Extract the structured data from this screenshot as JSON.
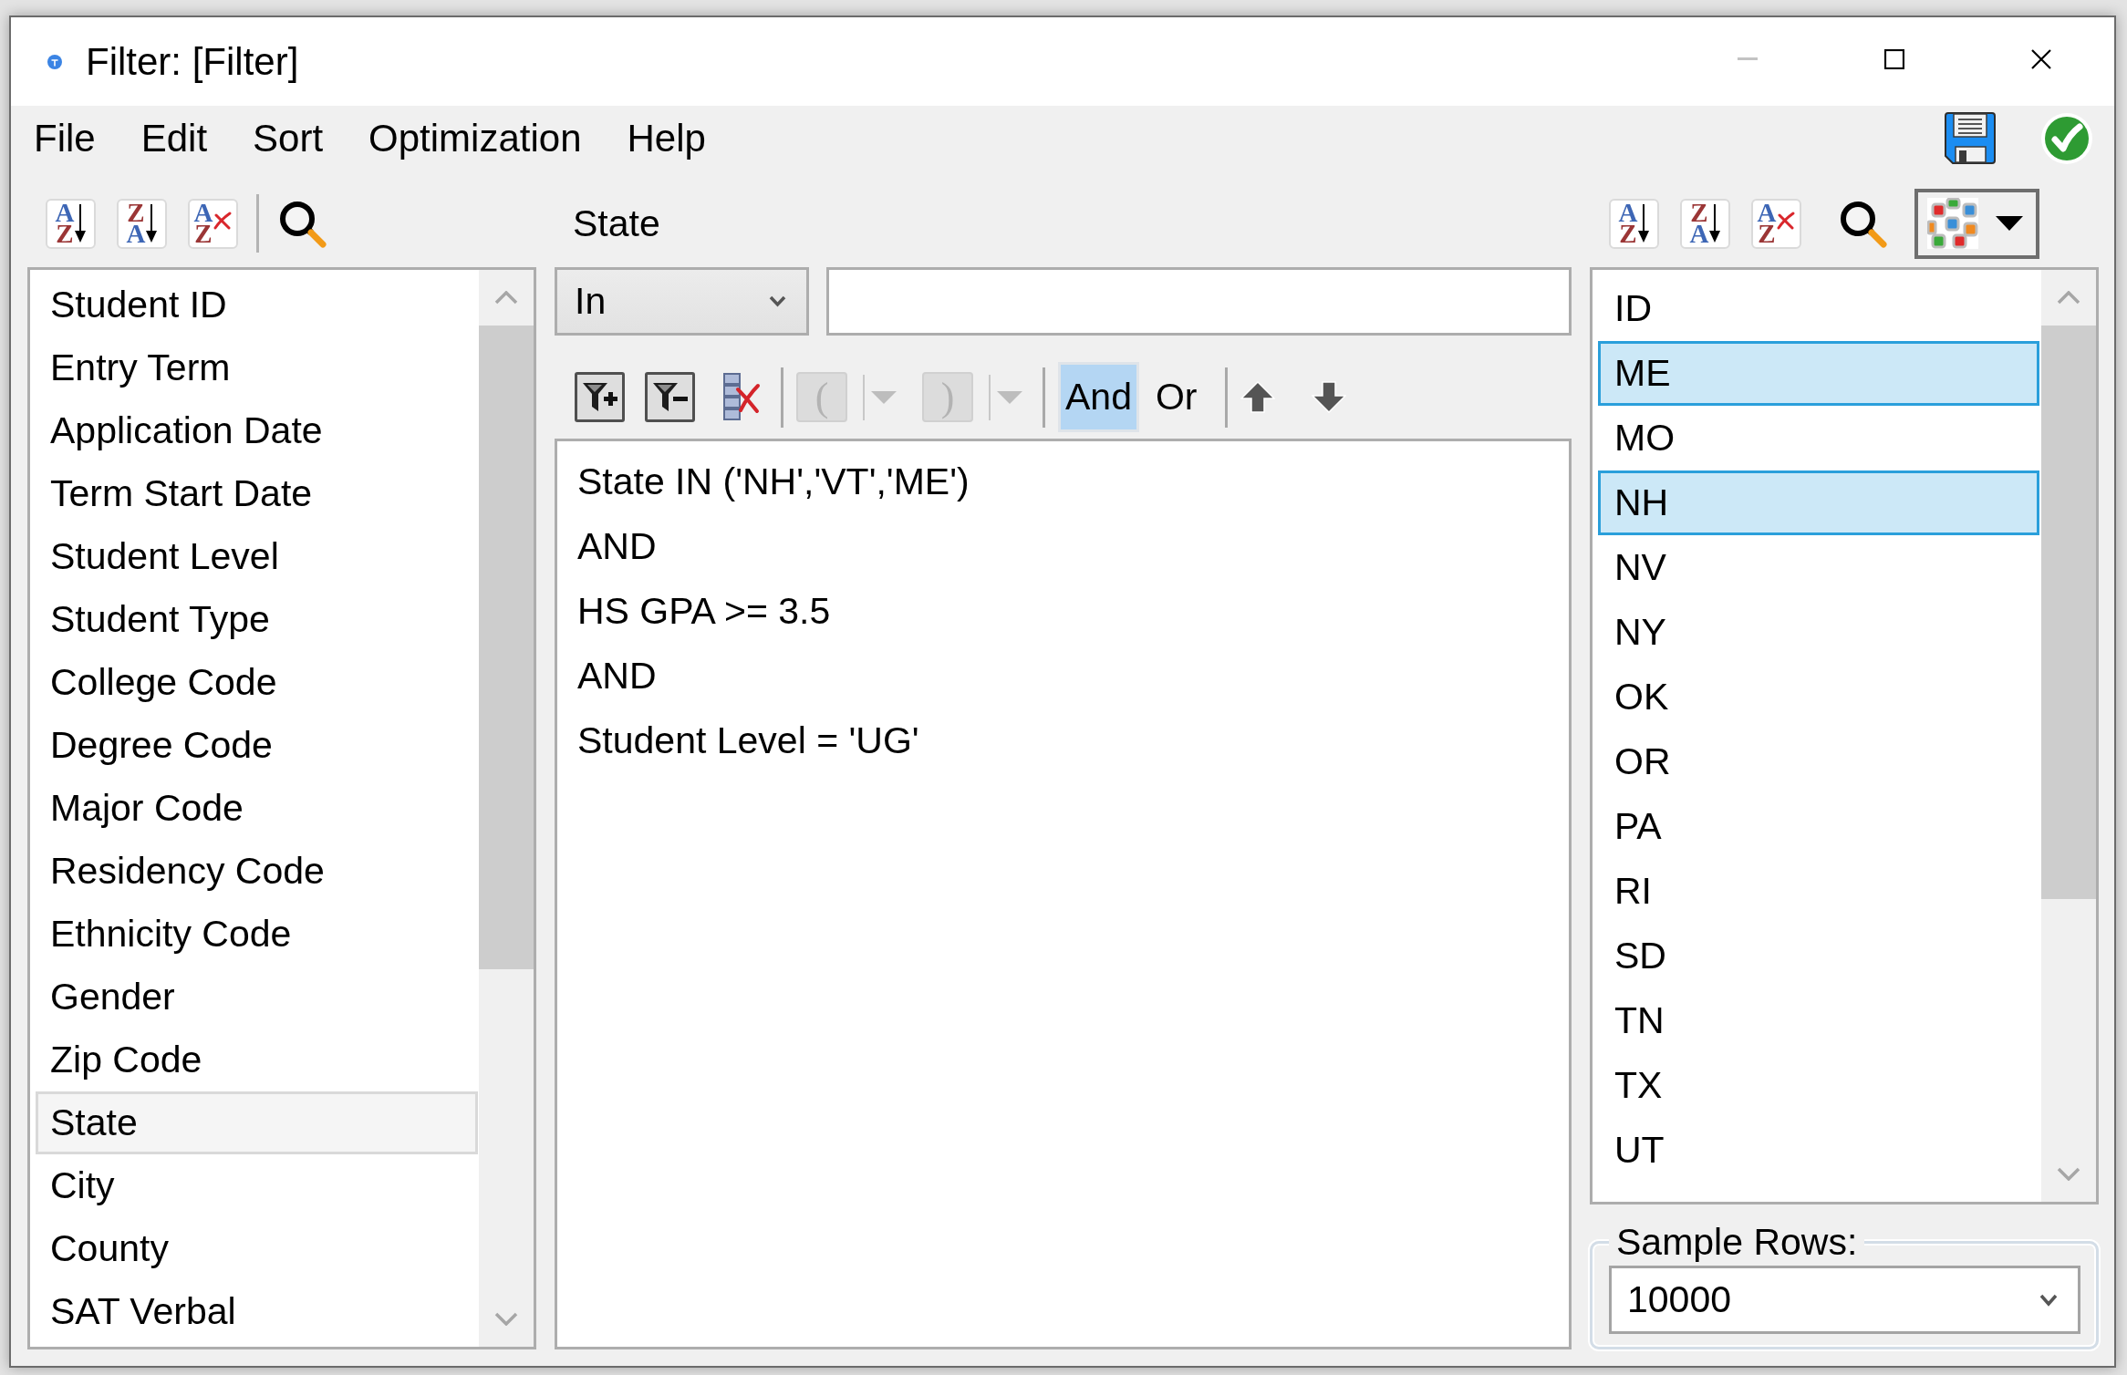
{
  "window": {
    "title": "Filter: [Filter]",
    "controls": [
      {
        "kind": "minimize",
        "disabled": true
      },
      {
        "kind": "maximize",
        "disabled": false
      },
      {
        "kind": "close",
        "disabled": false
      }
    ]
  },
  "menu": [
    "File",
    "Edit",
    "Sort",
    "Optimization",
    "Help"
  ],
  "menu_actions": [
    {
      "kind": "save"
    },
    {
      "kind": "apply"
    }
  ],
  "field_toolbar": {
    "groups": [
      [
        {
          "kind": "sort_ascending",
          "glyphs": [
            "A",
            "Z"
          ]
        },
        {
          "kind": "sort_descending",
          "glyphs": [
            "Z",
            "A"
          ]
        },
        {
          "kind": "clear_sort",
          "glyphs": [
            "A",
            "Z"
          ]
        }
      ],
      [
        {
          "kind": "search"
        }
      ]
    ]
  },
  "field_list": {
    "items": [
      {
        "label": "Student ID",
        "selected": false
      },
      {
        "label": "Entry Term",
        "selected": false
      },
      {
        "label": "Application Date",
        "selected": false
      },
      {
        "label": "Term Start Date",
        "selected": false
      },
      {
        "label": "Student Level",
        "selected": false
      },
      {
        "label": "Student Type",
        "selected": false
      },
      {
        "label": "College Code",
        "selected": false
      },
      {
        "label": "Degree Code",
        "selected": false
      },
      {
        "label": "Major Code",
        "selected": false
      },
      {
        "label": "Residency Code",
        "selected": false
      },
      {
        "label": "Ethnicity Code",
        "selected": false
      },
      {
        "label": "Gender",
        "selected": false
      },
      {
        "label": "Zip Code",
        "selected": false
      },
      {
        "label": "State",
        "selected": true
      },
      {
        "label": "City",
        "selected": false
      },
      {
        "label": "County",
        "selected": false
      },
      {
        "label": "SAT Verbal",
        "selected": false
      }
    ]
  },
  "condition": {
    "field": "State",
    "operator": "In"
  },
  "condition_toolbar": {
    "groups": [
      [
        {
          "kind": "add_filter"
        },
        {
          "kind": "remove_filter"
        },
        {
          "kind": "clear"
        }
      ],
      [
        {
          "kind": "paren",
          "label": "(",
          "disabled": true
        },
        {
          "kind": "paren",
          "label": ")",
          "disabled": true
        }
      ],
      [
        {
          "kind": "logic",
          "label": "And",
          "selected": true
        },
        {
          "kind": "logic",
          "label": "Or",
          "selected": false
        }
      ],
      [
        {
          "kind": "move_up"
        },
        {
          "kind": "move_down"
        }
      ]
    ]
  },
  "expression": [
    "State IN ('NH','VT','ME')",
    "AND",
    "HS GPA >= 3.5",
    "AND",
    "Student Level = 'UG'"
  ],
  "value_toolbar": {
    "groups": [
      [
        {
          "kind": "sort_ascending",
          "glyphs": [
            "A",
            "Z"
          ]
        },
        {
          "kind": "sort_descending",
          "glyphs": [
            "Z",
            "A"
          ]
        },
        {
          "kind": "clear_sort",
          "glyphs": [
            "A",
            "Z"
          ]
        },
        {
          "kind": "search"
        },
        {
          "kind": "palette"
        }
      ]
    ]
  },
  "value_list": {
    "items": [
      {
        "label": "ID",
        "selected": false
      },
      {
        "label": "ME",
        "selected": true
      },
      {
        "label": "MO",
        "selected": false
      },
      {
        "label": "NH",
        "selected": true
      },
      {
        "label": "NV",
        "selected": false
      },
      {
        "label": "NY",
        "selected": false
      },
      {
        "label": "OK",
        "selected": false
      },
      {
        "label": "OR",
        "selected": false
      },
      {
        "label": "PA",
        "selected": false
      },
      {
        "label": "RI",
        "selected": false
      },
      {
        "label": "SD",
        "selected": false
      },
      {
        "label": "TN",
        "selected": false
      },
      {
        "label": "TX",
        "selected": false
      },
      {
        "label": "UT",
        "selected": false
      }
    ]
  },
  "sample_rows": {
    "label": "Sample Rows:",
    "value": "10000"
  }
}
